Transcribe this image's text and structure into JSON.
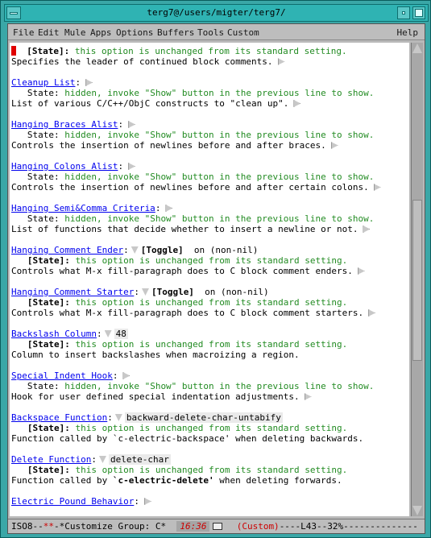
{
  "window": {
    "title": "terg7@/users/migter/terg7/"
  },
  "menubar": {
    "items": [
      "File",
      "Edit",
      "Mule",
      "Apps",
      "Options",
      "Buffers",
      "Tools",
      "Custom"
    ],
    "help": "Help"
  },
  "content": {
    "lines": {
      "l0_state": "[State]:",
      "l0_msg": " this option is unchanged from its standard setting.",
      "l1": "Specifies the leader of continued block comments.",
      "cleanup_title": "Cleanup List",
      "cleanup_state": "   State:",
      "cleanup_state_msg": " hidden, invoke \"Show\" button in the previous line to show.",
      "cleanup_doc": "List of various C/C++/ObjC constructs to \"clean up\".",
      "braces_title": "Hanging Braces Alist",
      "braces_state": "   State:",
      "braces_state_msg": " hidden, invoke \"Show\" button in the previous line to show.",
      "braces_doc": "Controls the insertion of newlines before and after braces.",
      "colons_title": "Hanging Colons Alist",
      "colons_state": "   State:",
      "colons_state_msg": " hidden, invoke \"Show\" button in the previous line to show.",
      "colons_doc": "Controls the insertion of newlines before and after certain colons.",
      "semi_title": "Hanging Semi&Comma Criteria",
      "semi_state": "   State:",
      "semi_state_msg": " hidden, invoke \"Show\" button in the previous line to show.",
      "semi_doc": "List of functions that decide whether to insert a newline or not.",
      "ender_title": "Hanging Comment Ender",
      "ender_toggle": "[Toggle]",
      "ender_value": "  on (non-nil)",
      "ender_state": "   [State]:",
      "ender_state_msg": " this option is unchanged from its standard setting.",
      "ender_doc": "Controls what M-x fill-paragraph does to C block comment enders.",
      "starter_title": "Hanging Comment Starter",
      "starter_toggle": "[Toggle]",
      "starter_value": "  on (non-nil)",
      "starter_state": "   [State]:",
      "starter_state_msg": " this option is unchanged from its standard setting.",
      "starter_doc": "Controls what M-x fill-paragraph does to C block comment starters.",
      "backslash_title": "Backslash Column",
      "backslash_value": "48",
      "backslash_state": "   [State]:",
      "backslash_state_msg": " this option is unchanged from its standard setting.",
      "backslash_doc": "Column to insert backslashes when macroizing a region.",
      "indent_title": "Special Indent Hook",
      "indent_state": "   State:",
      "indent_state_msg": " hidden, invoke \"Show\" button in the previous line to show.",
      "indent_doc": "Hook for user defined special indentation adjustments.",
      "backspace_title": "Backspace Function",
      "backspace_value": "backward-delete-char-untabify",
      "backspace_state": "   [State]:",
      "backspace_state_msg": " this option is unchanged from its standard setting.",
      "backspace_doc": "Function called by `c-electric-backspace' when deleting backwards.",
      "delete_title": "Delete Function",
      "delete_value": "delete-char",
      "delete_state": "   [State]:",
      "delete_state_msg": " this option is unchanged from its standard setting.",
      "delete_doc_pre": "Function called by ",
      "delete_doc_bold": "`c-electric-delete'",
      "delete_doc_post": " when deleting forwards.",
      "pound_title": "Electric Pound Behavior"
    }
  },
  "modeline": {
    "left": "ISO8--",
    "stars": "**",
    "mid": "-*Customize Group: C*",
    "time": "16:36",
    "mode": "(Custom)",
    "pos": "----L43--32%--------------"
  },
  "colors": {
    "link": "#0000ee",
    "state_green": "#228b22",
    "cursor_red": "#e00000"
  }
}
